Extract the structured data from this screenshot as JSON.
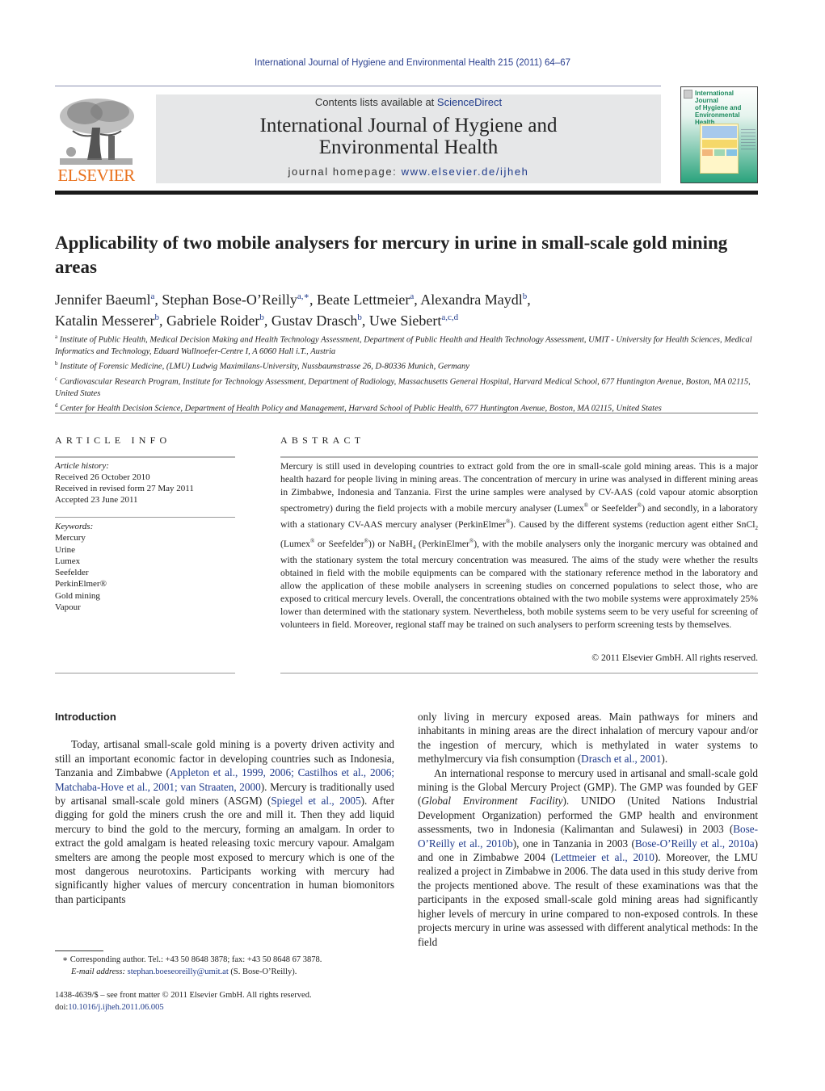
{
  "running_head": "International Journal of Hygiene and Environmental Health 215 (2011) 64–67",
  "publisher": {
    "logo_word": "ELSEVIER",
    "logo_color": "#e9711c"
  },
  "masthead": {
    "contents_prefix": "Contents lists available at ",
    "contents_link": "ScienceDirect",
    "journal_title_line1": "International Journal of Hygiene and",
    "journal_title_line2": "Environmental Health",
    "homepage_prefix": "journal homepage: ",
    "homepage_link": "www.elsevier.de/ijheh"
  },
  "cover": {
    "title_line1": "International Journal",
    "title_line2": "of Hygiene and",
    "title_line3": "Environmental Health"
  },
  "article": {
    "title": "Applicability of two mobile analysers for mercury in urine in small-scale gold mining areas",
    "authors": [
      {
        "name": "Jennifer Baeuml",
        "sup": "a",
        "sep": ", "
      },
      {
        "name": "Stephan Bose-O’Reilly",
        "sup": "a,∗",
        "sep": ", "
      },
      {
        "name": "Beate Lettmeier",
        "sup": "a",
        "sep": ", "
      },
      {
        "name": "Alexandra Maydl",
        "sup": "b",
        "sep": ","
      },
      {
        "name": "Katalin Messerer",
        "sup": "b",
        "sep": ", "
      },
      {
        "name": "Gabriele Roider",
        "sup": "b",
        "sep": ", "
      },
      {
        "name": "Gustav Drasch",
        "sup": "b",
        "sep": ", "
      },
      {
        "name": "Uwe Siebert",
        "sup": "a,c,d",
        "sep": ""
      }
    ],
    "affiliations": [
      {
        "key": "a",
        "text": "Institute of Public Health, Medical Decision Making and Health Technology Assessment, Department of Public Health and Health Technology Assessment, UMIT - University for Health Sciences, Medical Informatics and Technology, Eduard Wallnoefer-Centre I, A 6060 Hall i.T., Austria"
      },
      {
        "key": "b",
        "text": "Institute of Forensic Medicine, (LMU) Ludwig Maximilans-University, Nussbaumstrasse 26, D-80336 Munich, Germany"
      },
      {
        "key": "c",
        "text": "Cardiovascular Research Program, Institute for Technology Assessment, Department of Radiology, Massachusetts General Hospital, Harvard Medical School, 677 Huntington Avenue, Boston, MA 02115, United States"
      },
      {
        "key": "d",
        "text": "Center for Health Decision Science, Department of Health Policy and Management, Harvard School of Public Health, 677 Huntington Avenue, Boston, MA 02115, United States"
      }
    ]
  },
  "article_info": {
    "heading": "ARTICLE INFO",
    "history_label": "Article history:",
    "history": [
      "Received 26 October 2010",
      "Received in revised form 27 May 2011",
      "Accepted 23 June 2011"
    ],
    "keywords_label": "Keywords:",
    "keywords": [
      "Mercury",
      "Urine",
      "Lumex",
      "Seefelder",
      "PerkinElmer®",
      "Gold mining",
      "Vapour"
    ]
  },
  "abstract": {
    "heading": "ABSTRACT",
    "seg1": "Mercury is still used in developing countries to extract gold from the ore in small-scale gold mining areas. This is a major health hazard for people living in mining areas. The concentration of mercury in urine was analysed in different mining areas in Zimbabwe, Indonesia and Tanzania. First the urine samples were analysed by CV-AAS (cold vapour atomic absorption spectrometry) during the field projects with a mobile mercury analyser (Lumex",
    "reg": "®",
    "seg2": " or Seefelder",
    "seg3": ") and secondly, in a laboratory with a stationary CV-AAS mercury analyser (PerkinElmer",
    "seg4": "). Caused by the different systems (reduction agent either SnCl",
    "sub2": "2",
    "seg5": " (Lumex",
    "seg6": " or Seefelder",
    "seg7": ")) or NaBH",
    "sub4": "4",
    "seg8": " (PerkinElmer",
    "seg9": "), with the mobile analysers only the inorganic mercury was obtained and with the stationary system the total mercury concentration was measured. The aims of the study were whether the results obtained in field with the mobile equipments can be compared with the stationary reference method in the laboratory and allow the application of these mobile analysers in screening studies on concerned populations to select those, who are exposed to critical mercury levels. Overall, the concentrations obtained with the two mobile systems were approximately 25% lower than determined with the stationary system. Nevertheless, both mobile systems seem to be very useful for screening of volunteers in field. Moreover, regional staff may be trained on such analysers to perform screening tests by themselves.",
    "copyright": "© 2011 Elsevier GmbH. All rights reserved."
  },
  "body": {
    "intro_heading": "Introduction",
    "p1": {
      "t1": "Today, artisanal small-scale gold mining is a poverty driven activity and still an important economic factor in developing countries such as Indonesia, Tanzania and Zimbabwe (",
      "c1": "Appleton et al., 1999, 2006; Castilhos et al., 2006; Matchaba-Hove et al., 2001; van Straaten, 2000",
      "t2": "). Mercury is traditionally used by artisanal small-scale gold miners (ASGM) (",
      "c2": "Spiegel et al., 2005",
      "t3": "). After digging for gold the miners crush the ore and mill it. Then they add liquid mercury to bind the gold to the mercury, forming an amalgam. In order to extract the gold amalgam is heated releasing toxic mercury vapour. Amalgam smelters are among the people most exposed to mercury which is one of the most dangerous neurotoxins. Participants working with mercury had significantly higher values of mercury concentration in human biomonitors than participants"
    },
    "p1_cont": {
      "t1": "only living in mercury exposed areas. Main pathways for miners and inhabitants in mining areas are the direct inhalation of mercury vapour and/or the ingestion of mercury, which is methylated in water systems to methylmercury via fish consumption (",
      "c1": "Drasch et al., 2001",
      "t2": ")."
    },
    "p2": {
      "t1": "An international response to mercury used in artisanal and small-scale gold mining is the Global Mercury Project (GMP). The GMP was founded by GEF (",
      "i1": "Global Environment Facility",
      "t2": "). UNIDO (United Nations Industrial Development Organization) performed the GMP health and environment assessments, two in Indonesia (Kalimantan and Sulawesi) in 2003 (",
      "c1": "Bose-O’Reilly et al., 2010b",
      "t3": "), one in Tanzania in 2003 (",
      "c2": "Bose-O’Reilly et al., 2010a",
      "t4": ") and one in Zimbabwe 2004 (",
      "c3": "Lettmeier et al., 2010",
      "t5": "). Moreover, the LMU realized a project in Zimbabwe in 2006. The data used in this study derive from the projects mentioned above. The result of these examinations was that the participants in the exposed small-scale gold mining areas had significantly higher levels of mercury in urine compared to non-exposed controls. In these projects mercury in urine was assessed with different analytical methods: In the field"
    }
  },
  "footnote": {
    "marker": "∗",
    "corresponding": " Corresponding author. Tel.: +43 50 8648 3878; fax: +43 50 8648 67 3878.",
    "email_label": "E-mail address:",
    "email": "stephan.boeseoreilly@umit.at",
    "email_suffix": " (S. Bose-O’Reilly)."
  },
  "frontmatter": {
    "issn_line": "1438-4639/$ – see front matter © 2011 Elsevier GmbH. All rights reserved.",
    "doi_prefix": "doi:",
    "doi": "10.1016/j.ijheh.2011.06.005"
  }
}
